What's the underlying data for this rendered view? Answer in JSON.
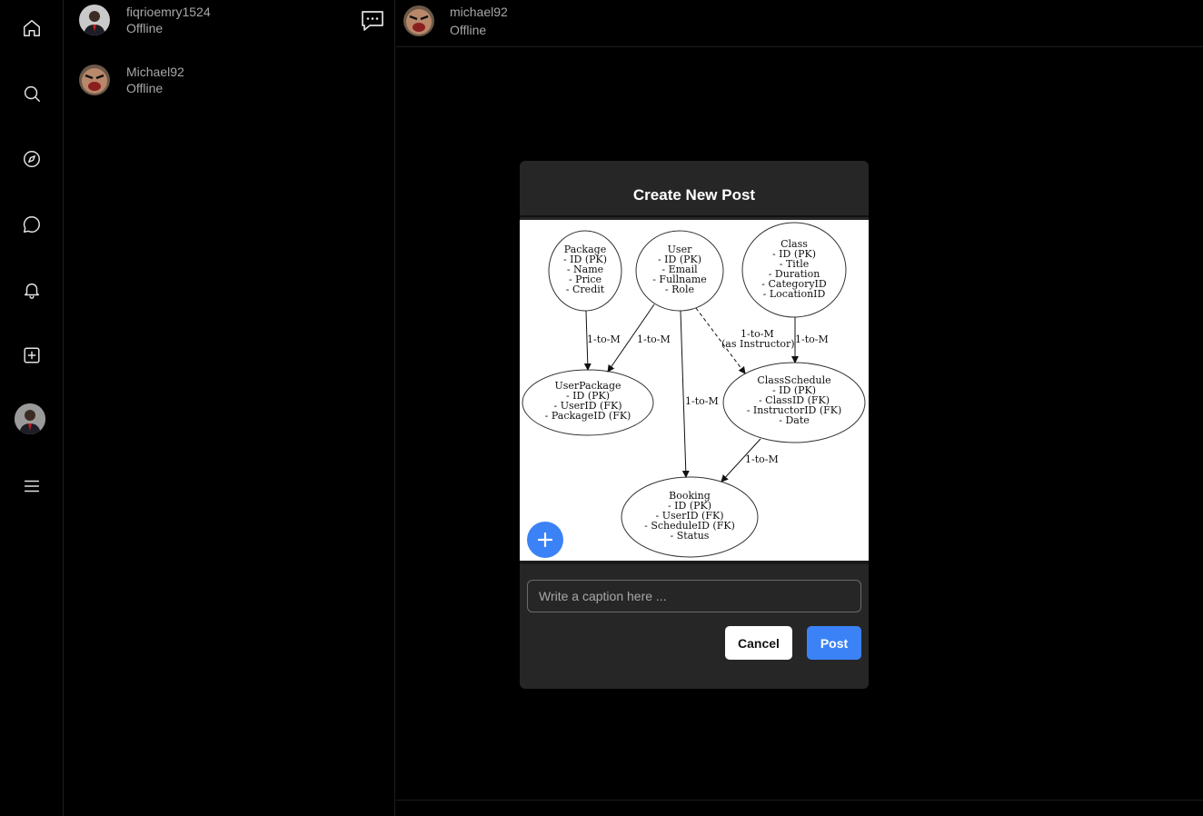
{
  "sidebar": {
    "items": [
      {
        "icon": "home-icon"
      },
      {
        "icon": "search-icon"
      },
      {
        "icon": "compass-icon"
      },
      {
        "icon": "message-icon"
      },
      {
        "icon": "bell-icon"
      },
      {
        "icon": "plus-square-icon"
      },
      {
        "icon": "profile-avatar"
      },
      {
        "icon": "menu-icon"
      }
    ]
  },
  "conversations": [
    {
      "name": "fiqrioemry1524",
      "status": "Offline"
    },
    {
      "name": "Michael92",
      "status": "Offline"
    }
  ],
  "chat": {
    "name": "michael92",
    "status": "Offline"
  },
  "modal": {
    "title": "Create New Post",
    "caption_placeholder": "Write a caption here ...",
    "cancel_label": "Cancel",
    "post_label": "Post",
    "accent_color": "#3b82f6"
  },
  "diagram": {
    "nodes": [
      {
        "id": "package",
        "lines": [
          "Package",
          "- ID (PK)",
          "- Name",
          "- Price",
          "- Credit"
        ]
      },
      {
        "id": "user",
        "lines": [
          "User",
          "- ID (PK)",
          "- Email",
          "- Fullname",
          "- Role"
        ]
      },
      {
        "id": "class",
        "lines": [
          "Class",
          "- ID (PK)",
          "- Title",
          "- Duration",
          "- CategoryID",
          "- LocationID"
        ]
      },
      {
        "id": "userpackage",
        "lines": [
          "UserPackage",
          "- ID (PK)",
          "- UserID (FK)",
          "- PackageID (FK)"
        ]
      },
      {
        "id": "classschedule",
        "lines": [
          "ClassSchedule",
          "- ID (PK)",
          "- ClassID (FK)",
          "- InstructorID (FK)",
          "- Date"
        ]
      },
      {
        "id": "booking",
        "lines": [
          "Booking",
          "- ID (PK)",
          "- UserID (FK)",
          "- ScheduleID (FK)",
          "- Status"
        ]
      }
    ],
    "edge_labels": {
      "package_userpackage": "1-to-M",
      "user_userpackage": "1-to-M",
      "user_classschedule_1": "1-to-M",
      "user_classschedule_2": "(as Instructor)",
      "class_classschedule": "1-to-M",
      "user_booking": "1-to-M",
      "classschedule_booking": "1-to-M"
    }
  }
}
